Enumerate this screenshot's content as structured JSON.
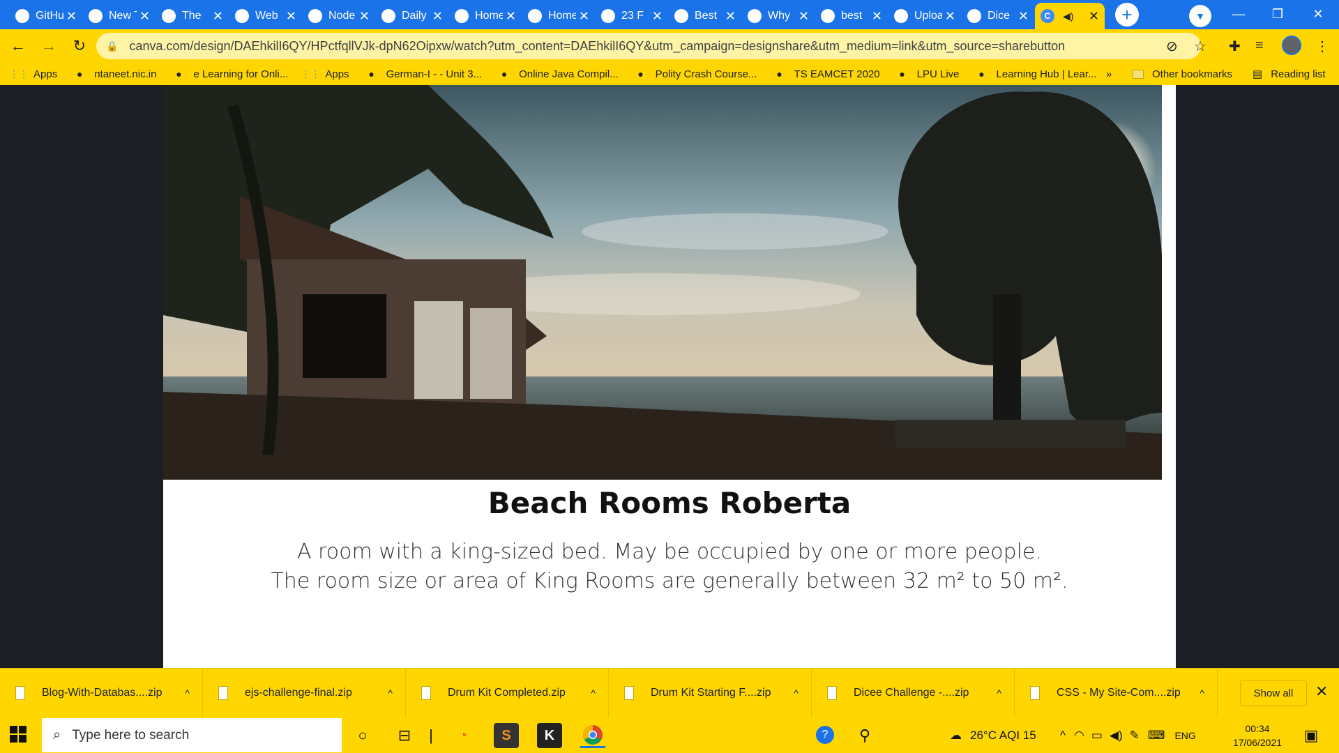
{
  "tabs": [
    {
      "title": "GitHub",
      "icon": "github-icon"
    },
    {
      "title": "New Tab",
      "icon": "none"
    },
    {
      "title": "The",
      "icon": "app-icon"
    },
    {
      "title": "Web",
      "icon": "web-icon"
    },
    {
      "title": "Node",
      "icon": "node-icon"
    },
    {
      "title": "Daily",
      "icon": "ui-icon"
    },
    {
      "title": "Home",
      "icon": "canva-icon"
    },
    {
      "title": "Home",
      "icon": "canva-icon"
    },
    {
      "title": "23 F",
      "icon": "calendar-icon"
    },
    {
      "title": "Best",
      "icon": "search-icon"
    },
    {
      "title": "Why",
      "icon": "alert-icon"
    },
    {
      "title": "best",
      "icon": "google-icon"
    },
    {
      "title": "Upload",
      "icon": "github-icon"
    },
    {
      "title": "Dice",
      "icon": "web-icon"
    }
  ],
  "active_tab": {
    "icon": "canva-icon"
  },
  "address_bar": {
    "url": "canva.com/design/DAEhkilI6QY/HPctfqllVJk-dpN62Oipxw/watch?utm_content=DAEhkilI6QY&utm_campaign=designshare&utm_medium=link&utm_source=sharebutton"
  },
  "bookmarks": [
    {
      "label": "Apps",
      "icon": "apps-grid-icon"
    },
    {
      "label": "ntaneet.nic.in",
      "icon": "globe-icon"
    },
    {
      "label": "e Learning for Onli...",
      "icon": "elearning-icon"
    },
    {
      "label": "Apps",
      "icon": "apps-grid-icon"
    },
    {
      "label": "German-I - - Unit 3...",
      "icon": "s-icon"
    },
    {
      "label": "Online Java Compil...",
      "icon": "java-icon"
    },
    {
      "label": "Polity Crash Course...",
      "icon": "cup-icon"
    },
    {
      "label": "TS EAMCET 2020",
      "icon": "globe-icon"
    },
    {
      "label": "LPU Live",
      "icon": "lpu-icon"
    },
    {
      "label": "Learning Hub | Lear...",
      "icon": "globe-icon"
    }
  ],
  "bookmarks_overflow": "»",
  "other_bookmarks": "Other bookmarks",
  "reading_list": "Reading list",
  "page": {
    "heading": "Beach Rooms Roberta",
    "description_line1": "A room with a king-sized bed. May be occupied by one or more people.",
    "description_line2": "The room size or area of King Rooms are generally between 32 m² to 50 m²."
  },
  "downloads": [
    "Blog-With-Databas....zip",
    "ejs-challenge-final.zip",
    "Drum Kit Completed.zip",
    "Drum Kit Starting F....zip",
    "Dicee Challenge -....zip",
    "CSS - My Site-Com....zip"
  ],
  "downloads_show_all": "Show all",
  "taskbar": {
    "search_placeholder": "Type here to search",
    "weather": "26°C  AQI 15",
    "language": "ENG",
    "time": "00:34",
    "date": "17/06/2021"
  },
  "colors": {
    "accent": "#1a73e8",
    "theme_yellow": "#ffd600"
  }
}
